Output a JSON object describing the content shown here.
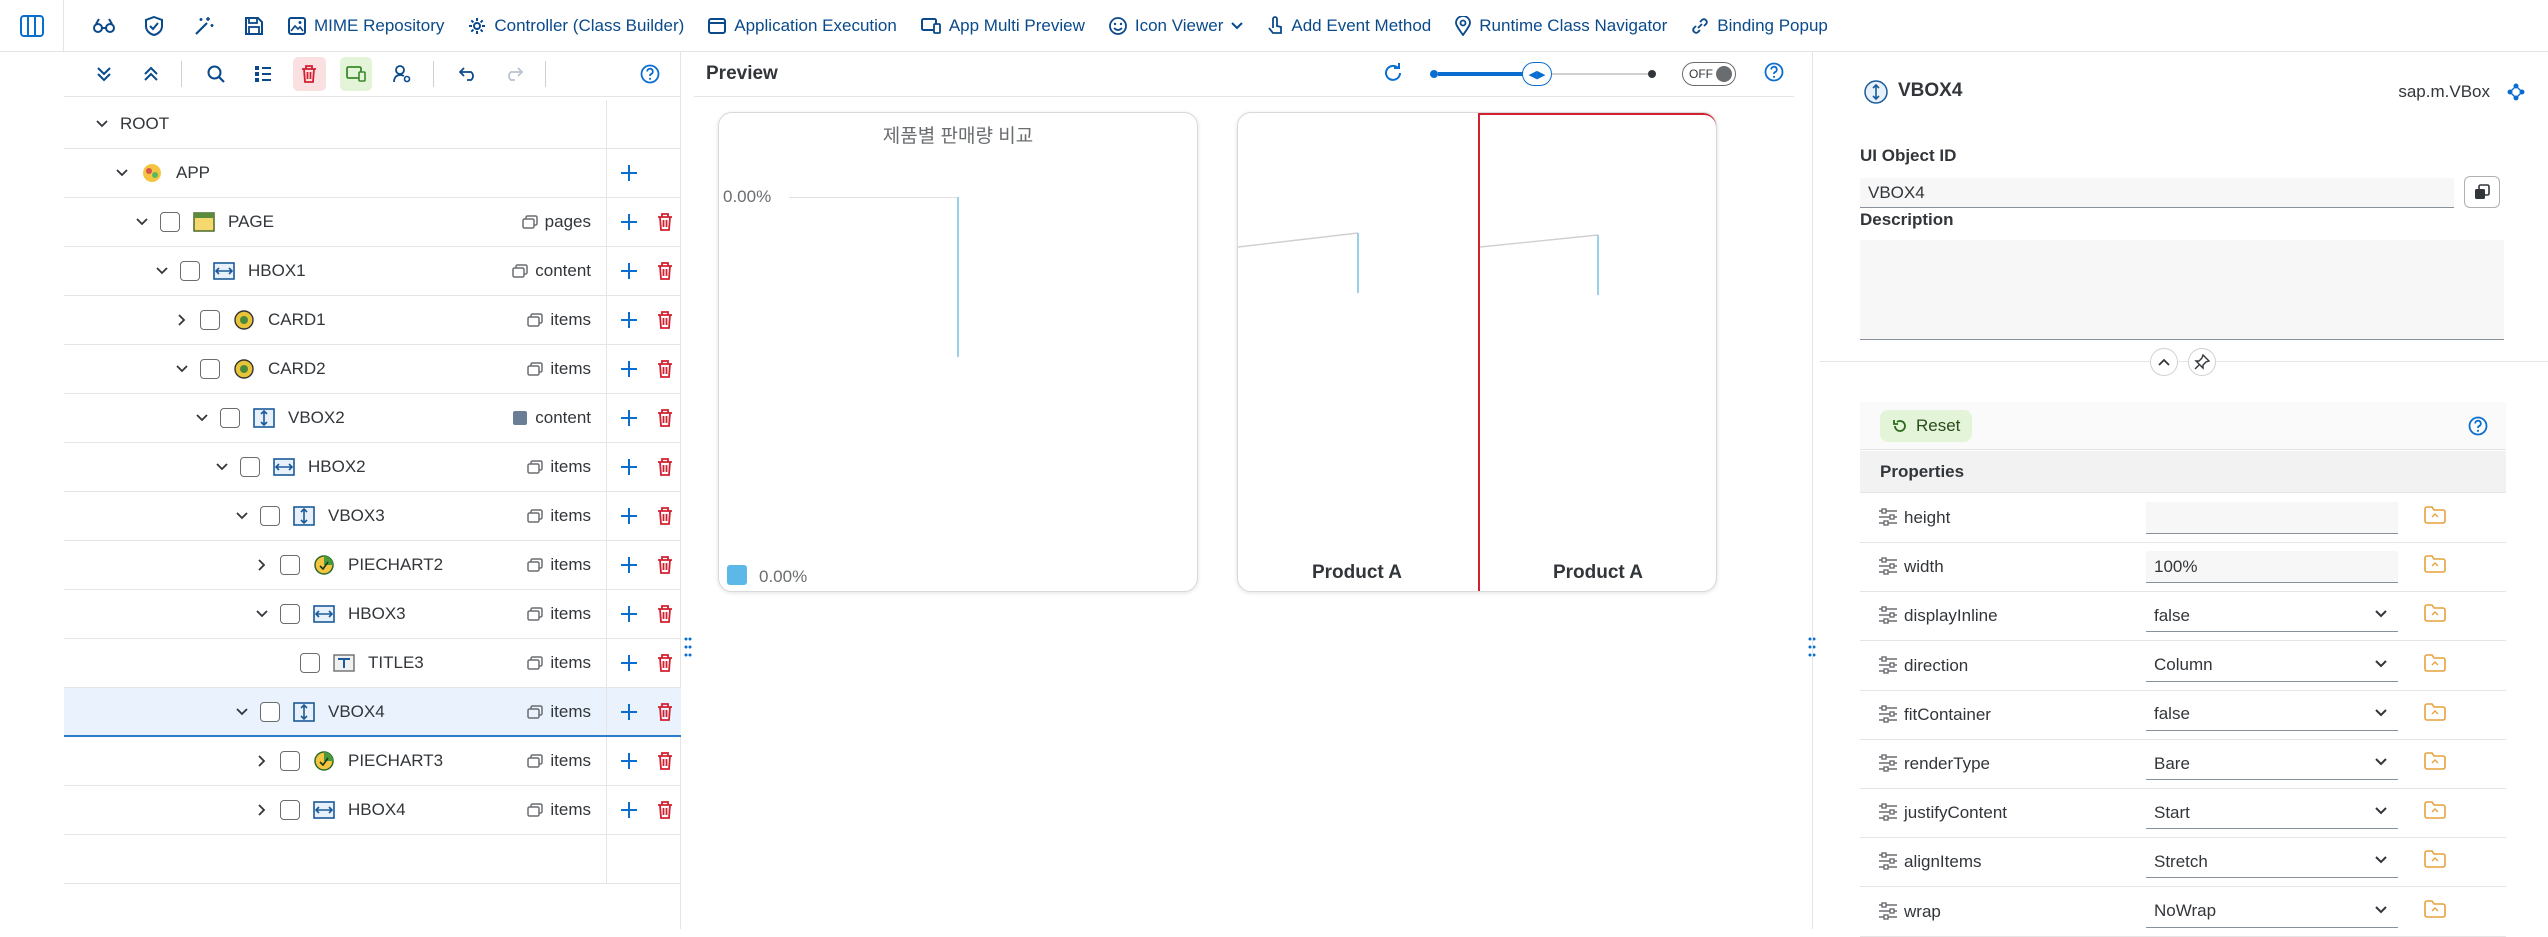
{
  "topbar": {
    "items": [
      {
        "label": "MIME Repository"
      },
      {
        "label": "Controller (Class Builder)"
      },
      {
        "label": "Application Execution"
      },
      {
        "label": "App Multi Preview"
      },
      {
        "label": "Icon Viewer"
      },
      {
        "label": "Add Event Method"
      },
      {
        "label": "Runtime Class Navigator"
      },
      {
        "label": "Binding Popup"
      }
    ]
  },
  "tree": {
    "root_label": "ROOT",
    "rows": [
      {
        "label": "APP",
        "aggregation": ""
      },
      {
        "label": "PAGE",
        "aggregation": "pages"
      },
      {
        "label": "HBOX1",
        "aggregation": "content"
      },
      {
        "label": "CARD1",
        "aggregation": "items"
      },
      {
        "label": "CARD2",
        "aggregation": "items"
      },
      {
        "label": "VBOX2",
        "aggregation": "content"
      },
      {
        "label": "HBOX2",
        "aggregation": "items"
      },
      {
        "label": "VBOX3",
        "aggregation": "items"
      },
      {
        "label": "PIECHART2",
        "aggregation": "items"
      },
      {
        "label": "HBOX3",
        "aggregation": "items"
      },
      {
        "label": "TITLE3",
        "aggregation": "items"
      },
      {
        "label": "VBOX4",
        "aggregation": "items"
      },
      {
        "label": "PIECHART3",
        "aggregation": "items"
      },
      {
        "label": "HBOX4",
        "aggregation": "items"
      }
    ]
  },
  "preview": {
    "title": "Preview",
    "toggle_label": "OFF",
    "card1": {
      "chart_title": "제품별 판매량 비교",
      "axis_label": "0.00%",
      "legend_label": "0.00%",
      "legend_color": "#5cb8e6"
    },
    "card2": {
      "label_left": "Product A",
      "label_right": "Product A",
      "highlight_color": "#d32030"
    }
  },
  "inspector": {
    "object_name": "VBOX4",
    "object_type": "sap.m.VBox",
    "id_label": "UI Object ID",
    "id_value": "VBOX4",
    "description_label": "Description",
    "description_value": "",
    "reset_label": "Reset",
    "properties_header": "Properties",
    "properties": [
      {
        "name": "height",
        "value": "",
        "kind": "input"
      },
      {
        "name": "width",
        "value": "100%",
        "kind": "input"
      },
      {
        "name": "displayInline",
        "value": "false",
        "kind": "select"
      },
      {
        "name": "direction",
        "value": "Column",
        "kind": "select"
      },
      {
        "name": "fitContainer",
        "value": "false",
        "kind": "select"
      },
      {
        "name": "renderType",
        "value": "Bare",
        "kind": "select"
      },
      {
        "name": "justifyContent",
        "value": "Start",
        "kind": "select"
      },
      {
        "name": "alignItems",
        "value": "Stretch",
        "kind": "select"
      },
      {
        "name": "wrap",
        "value": "NoWrap",
        "kind": "select"
      }
    ]
  },
  "colors": {
    "accent": "#0a6ed1",
    "delete": "#d32030",
    "selected_row": "#eaf3fd"
  }
}
